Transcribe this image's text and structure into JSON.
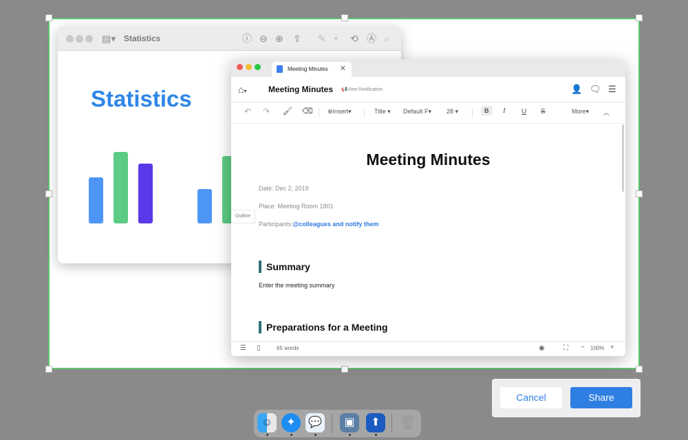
{
  "back_window": {
    "title": "Statistics",
    "heading": "Statistics",
    "bars": [
      {
        "color": "#4d96f6"
      },
      {
        "color": "#5ccb84"
      },
      {
        "color": "#5a39e8"
      },
      {
        "color": "#4d96f6"
      },
      {
        "color": "#5ccb84"
      }
    ]
  },
  "front_window": {
    "tab_label": "Meeting Minutes",
    "doc_title": "Meeting Minutes",
    "view_notification": "View Notification",
    "toolbar": {
      "insert": "Insert",
      "style": "Title",
      "font": "Default F",
      "size": "28",
      "bold": "B",
      "italic": "I",
      "underline": "U",
      "strike": "S",
      "more": "More"
    },
    "outline_label": "Outline",
    "heading": "Meeting Minutes",
    "date": "Date: Dec 2, 2019",
    "place": "Place: Meeting Room 1801",
    "participants_label": "Participants:",
    "participants_mention": "@colleagues and notify them",
    "summary_heading": "Summary",
    "summary_text": "Enter the meeting summary",
    "prep_heading": "Preparations for a Meeting",
    "word_count": "65 words",
    "zoom": "100%"
  },
  "actions": {
    "cancel": "Cancel",
    "share": "Share"
  },
  "colors": {
    "accent": "#2f7fe3",
    "selection_border": "#5fc46f",
    "heading_bar": "#2f6f75"
  }
}
